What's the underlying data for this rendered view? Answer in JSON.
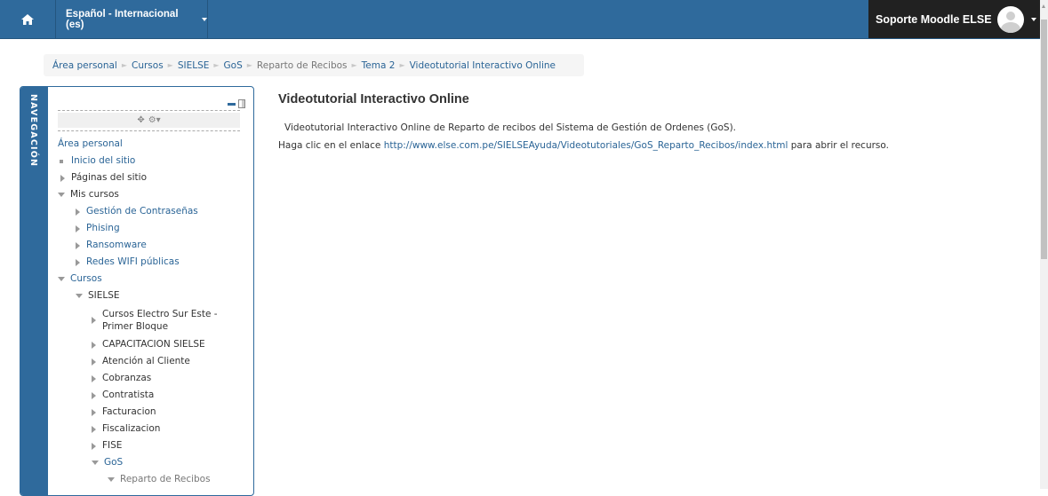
{
  "navbar": {
    "home_icon": "home-icon",
    "language": "Español - Internacional (es)",
    "user_name": "Soporte Moodle ELSE",
    "bg_color": "#2f6a9c"
  },
  "breadcrumb": {
    "items": [
      "Área personal",
      "Cursos",
      "SIELSE",
      "GoS",
      "Reparto de Recibos",
      "Tema 2",
      "Videotutorial Interactivo Online"
    ]
  },
  "navigation_block": {
    "title": "NAVEGACIÓN",
    "items": [
      "Área personal",
      "Inicio del sitio",
      "Páginas del sitio",
      "Mis cursos",
      "Gestión de Contraseñas",
      "Phising",
      "Ransomware",
      "Redes WIFI públicas",
      "Cursos",
      "SIELSE",
      "Cursos Electro Sur Este - Primer Bloque",
      "CAPACITACION SIELSE",
      "Atención al Cliente",
      "Cobranzas",
      "Contratista",
      "Facturacion",
      "Fiscalizacion",
      "FISE",
      "GoS",
      "Reparto de Recibos"
    ]
  },
  "main": {
    "title": "Videotutorial Interactivo Online",
    "intro": "Videotutorial Interactivo Online de Reparto de recibos del Sistema de Gestión de Ordenes (GoS).",
    "link_prefix": "Haga clic en el enlace",
    "link": "http://www.else.com.pe/SIELSEAyuda/Videotutoriales/GoS_Reparto_Recibos/index.html",
    "link_suffix": "para abrir el recurso."
  }
}
